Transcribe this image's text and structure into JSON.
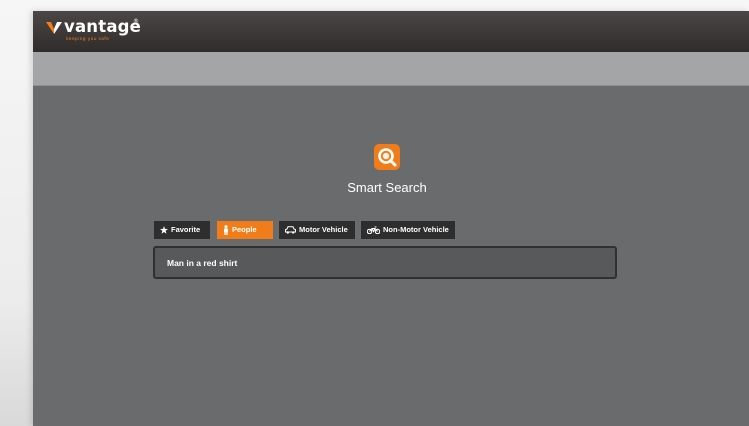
{
  "brand": {
    "name": "vantage",
    "registered": "®",
    "tagline": "keeping you safe",
    "accent_color": "#f07d19"
  },
  "page": {
    "title": "Smart Search",
    "icon": "magnifier-icon"
  },
  "tabs": [
    {
      "label": "Favorite",
      "icon": "star-icon",
      "active": false
    },
    {
      "label": "People",
      "icon": "person-icon",
      "active": true
    },
    {
      "label": "Motor Vehicle",
      "icon": "car-icon",
      "active": false
    },
    {
      "label": "Non-Motor Vehicle",
      "icon": "motorcycle-icon",
      "active": false
    }
  ],
  "search": {
    "value": "Man in a red shirt"
  }
}
